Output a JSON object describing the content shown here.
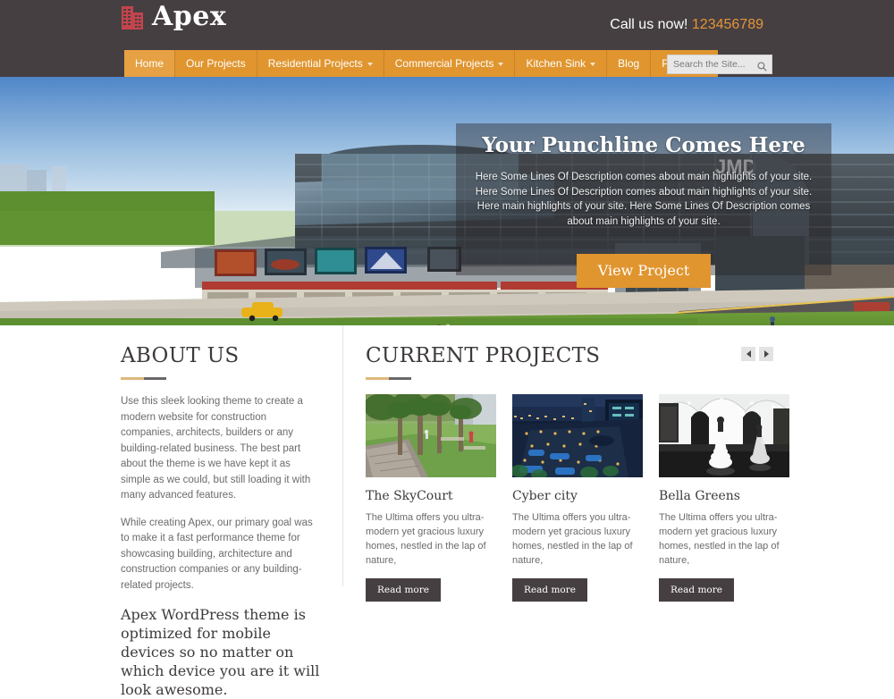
{
  "header": {
    "logo_text": "Apex",
    "logo_icon": "building-icon",
    "call_label": "Call us now!",
    "call_number": "123456789",
    "nav": [
      {
        "label": "Home",
        "has_caret": false,
        "active": true
      },
      {
        "label": "Our Projects",
        "has_caret": false,
        "active": false
      },
      {
        "label": "Residential Projects",
        "has_caret": true,
        "active": false
      },
      {
        "label": "Commercial Projects",
        "has_caret": true,
        "active": false
      },
      {
        "label": "Kitchen Sink",
        "has_caret": true,
        "active": false
      },
      {
        "label": "Blog",
        "has_caret": false,
        "active": false
      },
      {
        "label": "Purchase",
        "has_caret": false,
        "active": false
      }
    ],
    "search": {
      "placeholder": "Search the Site...",
      "value": "",
      "icon": "search-icon"
    }
  },
  "hero": {
    "title": "Your Punchline Comes Here",
    "description": "Here Some Lines Of Description comes about main highlights of your site. Here Some Lines Of Description comes about main highlights of your site. Here main highlights of your site. Here Some Lines Of Description comes about main highlights of your site.",
    "button_label": "View Project",
    "image_alt": "3D architectural rendering of a glass shopping mall with lawn, flower beds, pedestrians and a yellow taxi"
  },
  "about": {
    "title": "ABOUT US",
    "paragraph1": "Use this sleek looking theme to create a modern website for construction companies, architects, builders or any building-related business. The best part about the theme is we have kept it as simple as we could, but still loading it with many advanced features.",
    "paragraph2": "While creating Apex, our primary goal was to make it a fast performance theme for showcasing building, architecture and construction companies or any building-related projects.",
    "lead": "Apex WordPress theme is optimized for mobile devices so no matter on which device you are it will look awesome."
  },
  "projects": {
    "title": "CURRENT PROJECTS",
    "prev_label": "Previous",
    "next_label": "Next",
    "cards": [
      {
        "title": "The SkyCourt",
        "description": "The Ultima offers you ultra-modern yet gracious luxury homes, nestled in the lap of nature,",
        "button_label": "Read more",
        "image_alt": "Landscaped park with palm trees, green lawn and paved walkway"
      },
      {
        "title": "Cyber city",
        "description": "The Ultima offers you ultra-modern yet gracious luxury homes, nestled in the lap of nature,",
        "button_label": "Read more",
        "image_alt": "Night cityscape with blue-lit buildings and terraces"
      },
      {
        "title": "Bella Greens",
        "description": "The Ultima offers you ultra-modern yet gracious luxury homes, nestled in the lap of nature,",
        "button_label": "Read more",
        "image_alt": "White vaulted interior gallery with mannequins in gowns"
      }
    ]
  },
  "colors": {
    "header_bg": "#453f42",
    "accent_orange": "#e0952f",
    "nav_bg": "#e0952f",
    "logo_red": "#c4444c",
    "text_dark": "#3e3a3b",
    "text_muted": "#6d6a6b",
    "button_dark": "#463f41",
    "rule_gold": "#dcb87c",
    "rule_dark": "#6b6769"
  }
}
